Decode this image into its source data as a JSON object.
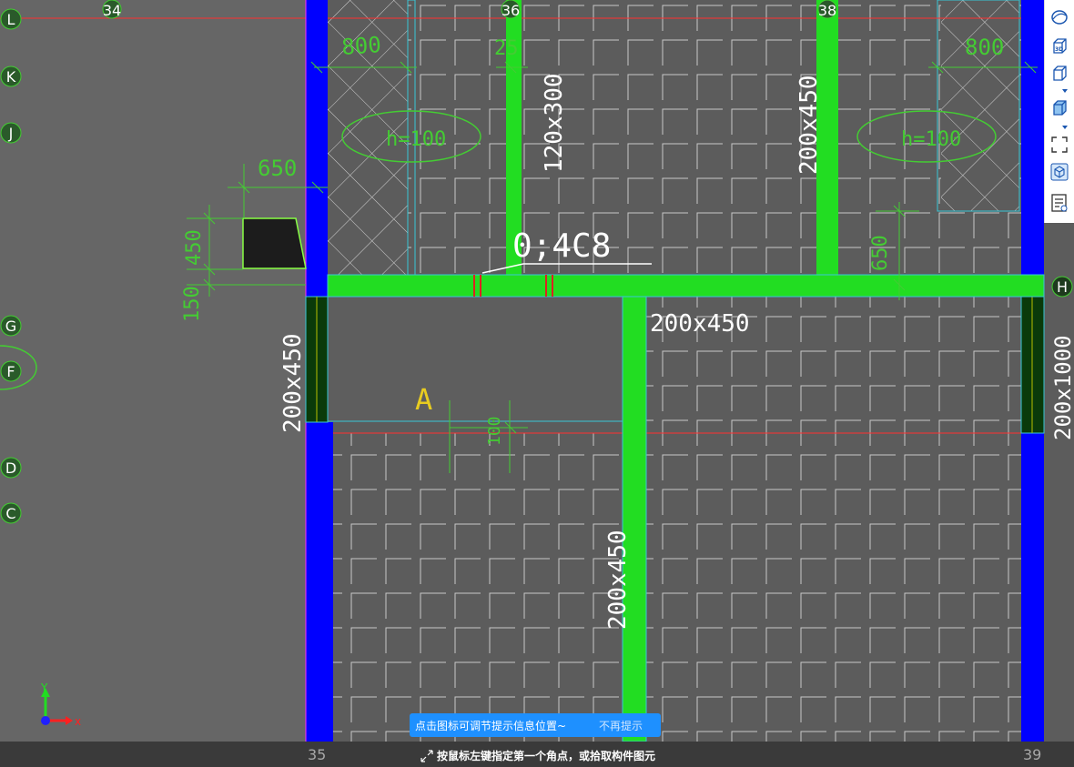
{
  "grid_columns": {
    "top": [
      "34",
      "36",
      "38"
    ],
    "bottom": [
      "35",
      "39"
    ]
  },
  "grid_rows": [
    "L",
    "K",
    "J",
    "H",
    "G",
    "F",
    "D",
    "C"
  ],
  "annotations": {
    "beam_label": "0;4C8",
    "beam_vertical_1": "120x300",
    "beam_vertical_2": "200x450",
    "beam_horizontal": "200x450",
    "column_left": "200x450",
    "beam_bottom": "200x450",
    "beam_right": "200x1000",
    "dim_800_left": "800",
    "dim_800_right": "800",
    "dim_25": "25",
    "dim_650_top": "650",
    "dim_650_right": "650",
    "dim_450": "450",
    "dim_150": "150",
    "dim_100": "100",
    "slab_h_left": "h=100",
    "slab_h_right": "h=100",
    "zone_label": "A"
  },
  "axis_icon": {
    "y": "Y",
    "x": "x"
  },
  "toolbar": {
    "items": [
      {
        "name": "orbit-icon"
      },
      {
        "name": "3d-view-icon",
        "label": "3D"
      },
      {
        "name": "box-view-icon"
      },
      {
        "name": "solid-box-icon"
      },
      {
        "name": "fit-screen-icon"
      },
      {
        "name": "cube-settings-icon"
      },
      {
        "name": "properties-list-icon"
      }
    ]
  },
  "tip": {
    "message": "点击图标可调节提示信息位置~",
    "dismiss": "不再提示"
  },
  "status": {
    "command": "按鼠标左键指定第一个角点，或拾取构件图元"
  },
  "colors": {
    "background": "#5c5c5c",
    "beam_green": "#22dd22",
    "column_blue": "#0000ff",
    "grid_red": "#ff3030",
    "dim_green": "#44cc33",
    "tip_blue": "#1e90ff"
  }
}
